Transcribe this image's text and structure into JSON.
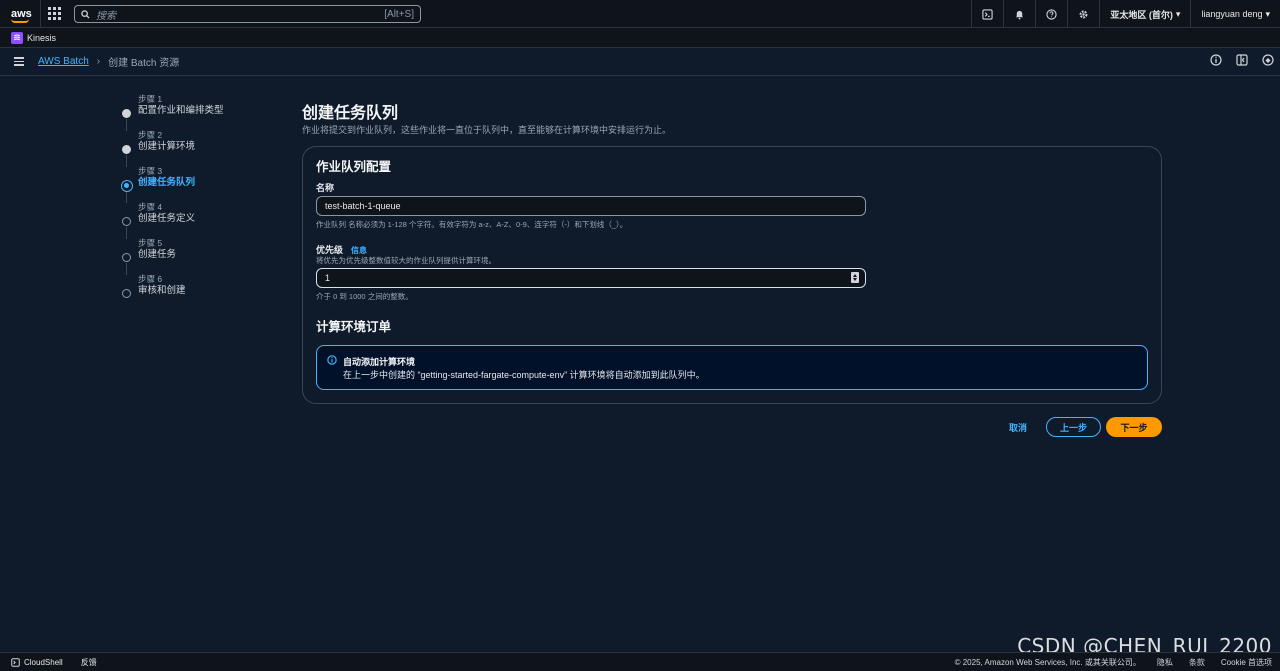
{
  "topnav": {
    "logo": "aws",
    "search_placeholder": "搜索",
    "search_shortcut": "[Alt+S]",
    "region": "亚太地区 (首尔)",
    "user": "liangyuan deng",
    "icons": [
      "cloudshell-icon",
      "bell-icon",
      "help-icon",
      "gear-icon"
    ]
  },
  "servicebar": {
    "service": "Kinesis"
  },
  "breadcrumb": {
    "root": "AWS Batch",
    "current": "创建 Batch 资源"
  },
  "steps": [
    {
      "num": "步骤 1",
      "name": "配置作业和编排类型",
      "state": "done"
    },
    {
      "num": "步骤 2",
      "name": "创建计算环境",
      "state": "done"
    },
    {
      "num": "步骤 3",
      "name": "创建任务队列",
      "state": "current"
    },
    {
      "num": "步骤 4",
      "name": "创建任务定义",
      "state": "pending"
    },
    {
      "num": "步骤 5",
      "name": "创建任务",
      "state": "pending"
    },
    {
      "num": "步骤 6",
      "name": "审核和创建",
      "state": "pending"
    }
  ],
  "main": {
    "title": "创建任务队列",
    "description": "作业将提交到作业队列，这些作业将一直位于队列中，直至能够在计算环境中安排运行为止。",
    "card_title": "作业队列配置",
    "name_label": "名称",
    "name_value": "test-batch-1-queue",
    "name_hint": "作业队列 名称必须为 1-128 个字符。有效字符为 a-z、A-Z、0-9、连字符（-）和下划线（_）。",
    "priority_label": "优先级",
    "priority_info": "信息",
    "priority_desc": "将优先为优先级整数值较大的作业队列提供计算环境。",
    "priority_value": "1",
    "priority_hint": "介于 0 到 1000 之间的整数。",
    "compute_order_title": "计算环境订单",
    "alert_title": "自动添加计算环境",
    "alert_body": "在上一步中创建的 “getting-started-fargate-compute-env” 计算环境将自动添加到此队列中。"
  },
  "actions": {
    "cancel": "取消",
    "prev": "上一步",
    "next": "下一步"
  },
  "footer": {
    "cloudshell": "CloudShell",
    "feedback": "反馈",
    "copyright": "© 2025, Amazon Web Services, Inc. 或其关联公司。",
    "privacy": "隐私",
    "terms": "条款",
    "cookies": "Cookie 首选项"
  },
  "watermark": "CSDN @CHEN_RUI_2200",
  "colors": {
    "accent": "#42b4ff",
    "primary_button": "#ff9900",
    "background": "#0f1b2a"
  }
}
